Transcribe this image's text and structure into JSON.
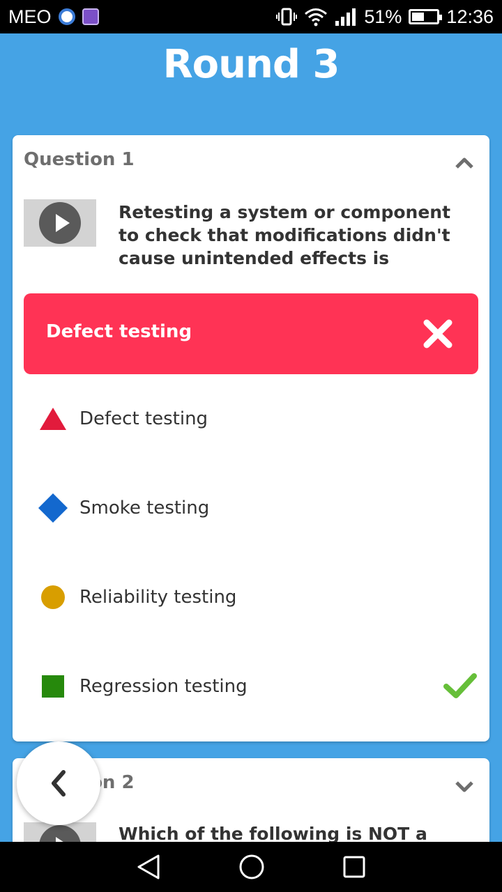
{
  "status_bar": {
    "carrier": "MEO",
    "battery_percent": "51%",
    "battery_level": 0.51,
    "time": "12:36"
  },
  "header": {
    "title": "Round 3"
  },
  "question1": {
    "label": "Question 1",
    "text": "Retesting a system or component to check that modifications didn't cause unintended effects is",
    "selected_answer": "Defect testing",
    "selected_correct": false,
    "options": [
      {
        "label": "Defect testing",
        "shape": "triangle",
        "color": "#e21b3c",
        "correct": false
      },
      {
        "label": "Smoke testing",
        "shape": "diamond",
        "color": "#1368ce",
        "correct": false
      },
      {
        "label": "Reliability testing",
        "shape": "circle",
        "color": "#d89e00",
        "correct": false
      },
      {
        "label": "Regression testing",
        "shape": "square",
        "color": "#26890c",
        "correct": true
      }
    ]
  },
  "question2": {
    "label": "Question 2",
    "text": "Which of the following is NOT a"
  },
  "colors": {
    "background": "#45a3e5",
    "wrong": "#ff3355",
    "check": "#66bf39"
  },
  "icons": {
    "collapse": "chevron-up-icon",
    "expand": "chevron-down-icon",
    "play": "play-icon",
    "wrong": "close-icon",
    "correct": "checkmark-icon",
    "back": "chevron-left-icon"
  }
}
